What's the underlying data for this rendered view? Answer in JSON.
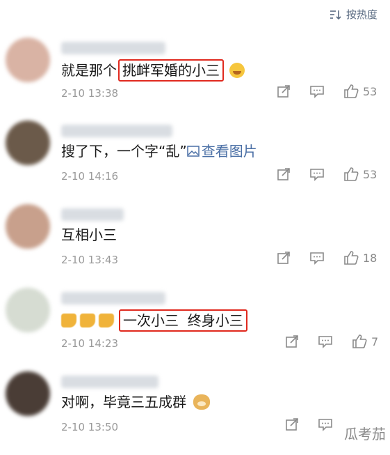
{
  "sort": {
    "label": "按热度",
    "icon": "sort-icon"
  },
  "comments": [
    {
      "avatar_color": "#d9b3a4",
      "segments": [
        "就是那个",
        "挑衅军婚的小三",
        ""
      ],
      "emoji": "laugh-cry-emoji",
      "time": "2-10 13:38",
      "likes": "53"
    },
    {
      "avatar_color": "#6b5a4a",
      "text": "搜了下，一个字“乱”",
      "image_link": "查看图片",
      "time": "2-10 14:16",
      "likes": "53"
    },
    {
      "avatar_color": "#c8a08c",
      "text": "互相小三",
      "time": "2-10 13:43",
      "likes": "18"
    },
    {
      "avatar_color": "#d6dcd2",
      "prefix_emoji": "thumbs-down-emoji",
      "highlight": "一次小三  终身小三",
      "time": "2-10 14:23",
      "likes": "7"
    },
    {
      "avatar_color": "#4a3d36",
      "text": "对啊，毕竟三五成群",
      "emoji": "doge-emoji",
      "time": "2-10 13:50",
      "likes": ""
    }
  ],
  "watermark": "瓜考茄",
  "colors": {
    "highlight_border": "#e0291e",
    "link": "#4a6fa5",
    "meta": "#9a9a9a"
  }
}
